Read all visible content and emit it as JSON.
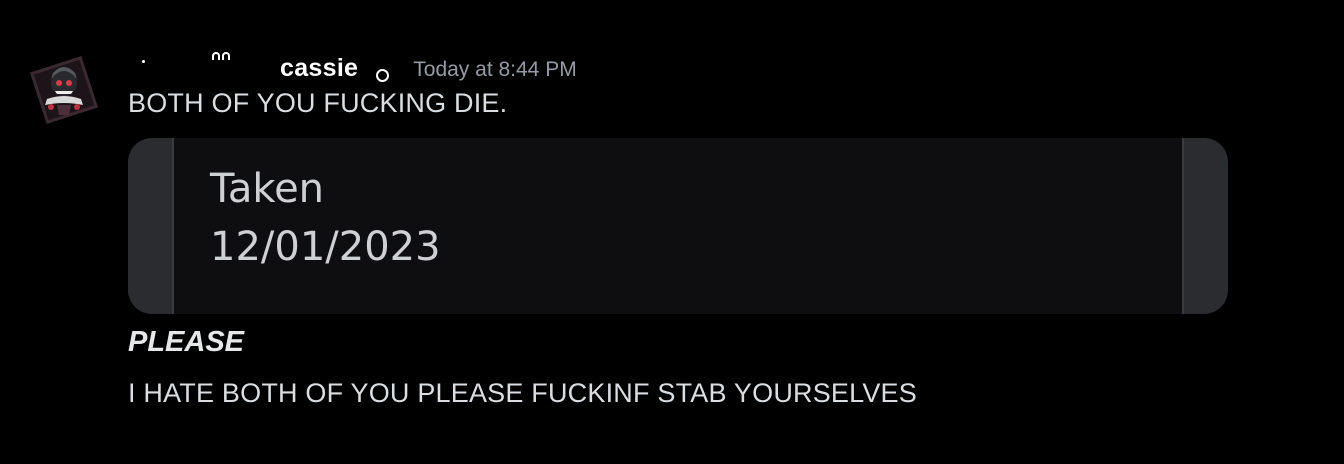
{
  "message": {
    "author": {
      "username": "cassie",
      "avatar_icon": "avatar-icon"
    },
    "timestamp": "Today at 8:44 PM",
    "lines": {
      "first": "BOTH OF YOU FUCKING DIE.",
      "second": "PLEASE",
      "third": "I HATE BOTH OF YOU PLEASE FUCKINF STAB YOURSELVES"
    },
    "embed": {
      "label": "Taken",
      "date": "12/01/2023"
    }
  },
  "colors": {
    "background": "#000000",
    "text": "#dbdee1",
    "username": "#ffffff",
    "timestamp": "#949ba4",
    "embed_bg": "#0e0e10",
    "embed_side": "#2b2c30"
  }
}
